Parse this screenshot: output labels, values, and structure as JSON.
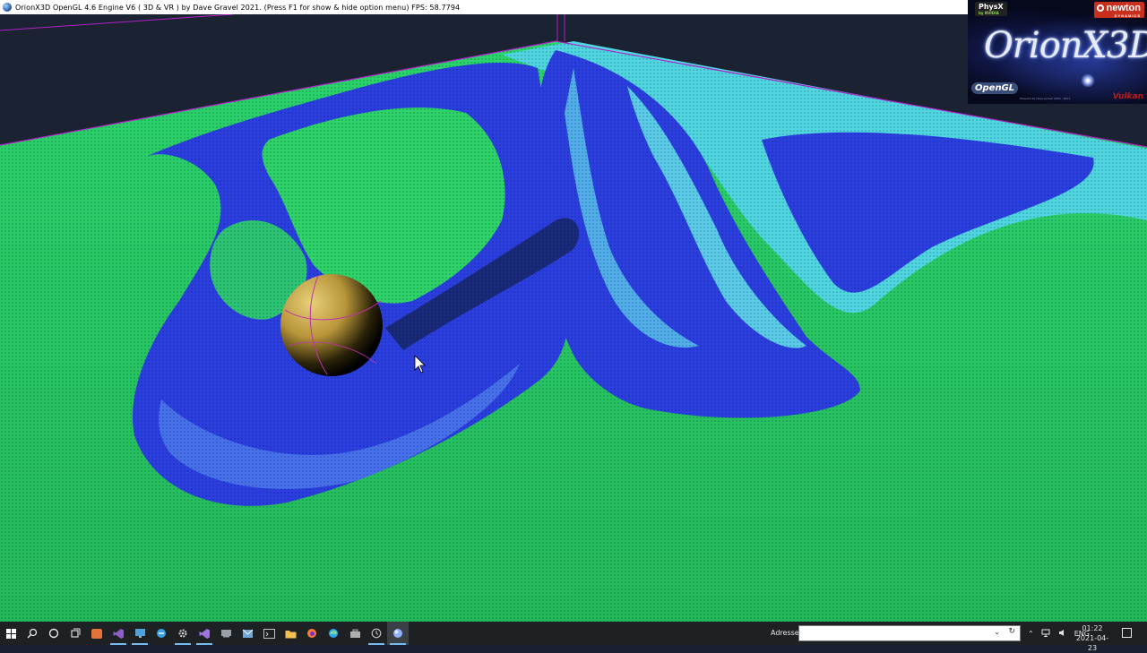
{
  "window": {
    "title": "OrionX3D OpenGL 4.6 Engine V6 ( 3D & VR ) by Dave Gravel 2021. (Press F1 for show & hide option menu) FPS: 58.7794",
    "app_icon": "orionx3d-sphere-icon"
  },
  "logo": {
    "brand": "OrionX3D",
    "physx": "PhysX",
    "physx_sub": "by NVIDIA",
    "newton": "newton",
    "newton_sub": "DYNAMICS",
    "opengl": "OpenGL",
    "vulkan": "Vulkan",
    "fine_print": "Powered by Dave Gravel 2000 - 2021"
  },
  "scene": {
    "colors": {
      "background": "#1b2232",
      "particles_green": "#2ed36a",
      "particles_blue": "#2b3fe0",
      "particles_cyan": "#5fe0e8",
      "container_edge": "#b020c8",
      "sphere": "#c9a843"
    }
  },
  "taskbar": {
    "icons": [
      {
        "name": "start-windows-icon"
      },
      {
        "name": "search-icon"
      },
      {
        "name": "cortana-circle-icon"
      },
      {
        "name": "task-view-icon"
      },
      {
        "name": "office-icon",
        "color": "#e3733a"
      },
      {
        "name": "visual-studio-icon",
        "color": "#8b5fc7"
      },
      {
        "name": "monitor-app-icon",
        "color": "#4aa3df"
      },
      {
        "name": "edge-legacy-icon",
        "color": "#3aa0e0"
      },
      {
        "name": "settings-gear-icon",
        "color": "#d0d0d0"
      },
      {
        "name": "visual-studio-2019-icon",
        "color": "#a074e0"
      },
      {
        "name": "remote-desktop-icon",
        "color": "#9aa0a6"
      },
      {
        "name": "mail-icon",
        "color": "#6fa8dc"
      },
      {
        "name": "terminal-icon",
        "color": "#c0c0c0"
      },
      {
        "name": "file-explorer-icon",
        "color": "#f2c14e"
      },
      {
        "name": "firefox-icon",
        "color": "#ff7a2e"
      },
      {
        "name": "edge-icon",
        "color": "#2ea8e8"
      },
      {
        "name": "toolbox-icon",
        "color": "#b0b0b0"
      },
      {
        "name": "clock-app-icon",
        "color": "#c8c8c8"
      },
      {
        "name": "orionx3d-running-icon",
        "color": "#8fb0ff"
      }
    ],
    "address_label": "Adresse",
    "address_value": "",
    "tray": {
      "language": "ENG",
      "time": "01:22",
      "date": "2021-04-23"
    }
  }
}
